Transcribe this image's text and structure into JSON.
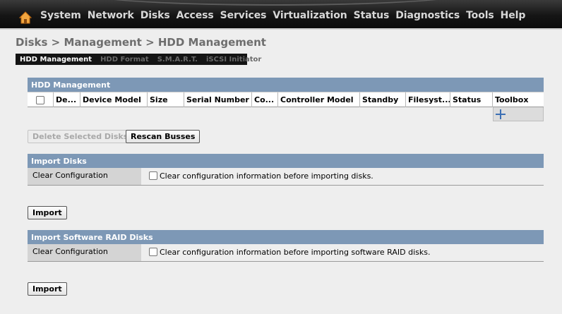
{
  "navbar": {
    "menu": [
      "System",
      "Network",
      "Disks",
      "Access",
      "Services",
      "Virtualization",
      "Status",
      "Diagnostics",
      "Tools",
      "Help"
    ]
  },
  "breadcrumb": "Disks > Management > HDD Management",
  "tabs": [
    {
      "label": "HDD Management",
      "active": true
    },
    {
      "label": "HDD Format",
      "active": false
    },
    {
      "label": "S.M.A.R.T.",
      "active": false
    },
    {
      "label": "iSCSI Initiator",
      "active": false
    }
  ],
  "hdd_section": {
    "title": "HDD Management",
    "columns": [
      "",
      "De...",
      "Device Model",
      "Size",
      "Serial Number",
      "Co...",
      "Controller Model",
      "Standby",
      "Filesyst...",
      "Status",
      "Toolbox"
    ]
  },
  "buttons": {
    "delete_selected": "Delete Selected Disks",
    "rescan": "Rescan Busses",
    "import": "Import"
  },
  "import_disks": {
    "title": "Import Disks",
    "label": "Clear Configuration",
    "checkbox_text": "Clear configuration information before importing disks."
  },
  "import_raid": {
    "title": "Import Software RAID Disks",
    "label": "Clear Configuration",
    "checkbox_text": "Clear configuration information before importing software RAID disks."
  },
  "colors": {
    "section_header": "#7d98b6",
    "navbar": "#151515",
    "add_icon": "#3c6fb4"
  },
  "icons": [
    "home-icon",
    "add-icon"
  ]
}
